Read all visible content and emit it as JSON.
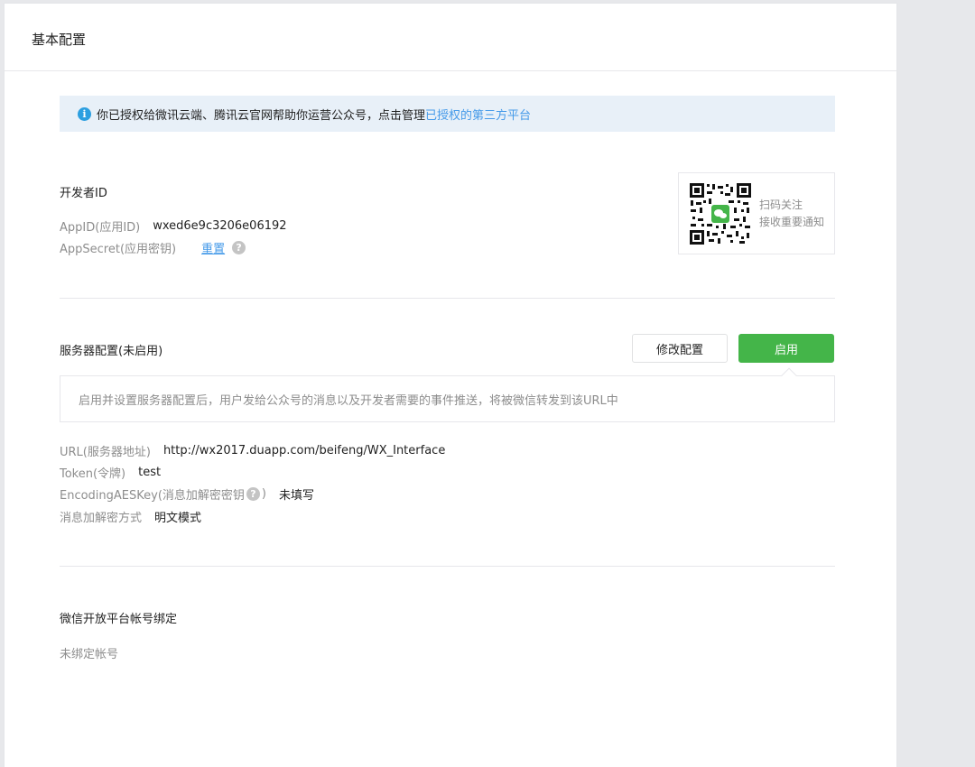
{
  "header": {
    "title": "基本配置"
  },
  "notice": {
    "text": "你已授权给微讯云端、腾讯云官网帮助你运营公众号，点击管理",
    "link_text": "已授权的第三方平台"
  },
  "developer": {
    "section_title": "开发者ID",
    "appid_label": "AppID(应用ID)",
    "appid_value": "wxed6e9c3206e06192",
    "appsecret_label": "AppSecret(应用密钥)",
    "reset_label": "重置"
  },
  "qr_card": {
    "line1": "扫码关注",
    "line2": "接收重要通知"
  },
  "server": {
    "section_title": "服务器配置(未启用)",
    "modify_button": "修改配置",
    "enable_button": "启用",
    "tip": "启用并设置服务器配置后，用户发给公众号的消息以及开发者需要的事件推送，将被微信转发到该URL中",
    "url_label": "URL(服务器地址)",
    "url_value": "http://wx2017.duapp.com/beifeng/WX_Interface",
    "token_label": "Token(令牌)",
    "token_value": "test",
    "aes_label_prefix": "EncodingAESKey(消息加解密密钥",
    "aes_label_suffix": ")",
    "aes_value": "未填写",
    "mode_label": "消息加解密方式",
    "mode_value": "明文模式"
  },
  "open_platform": {
    "section_title": "微信开放平台帐号绑定",
    "status": "未绑定帐号"
  },
  "colors": {
    "accent_green": "#44b549",
    "link_blue": "#459ae9",
    "info_blue": "#2c9fe0"
  },
  "icons": {
    "info": "info-icon",
    "help": "question-circle-icon",
    "qr": "qr-code-icon"
  }
}
